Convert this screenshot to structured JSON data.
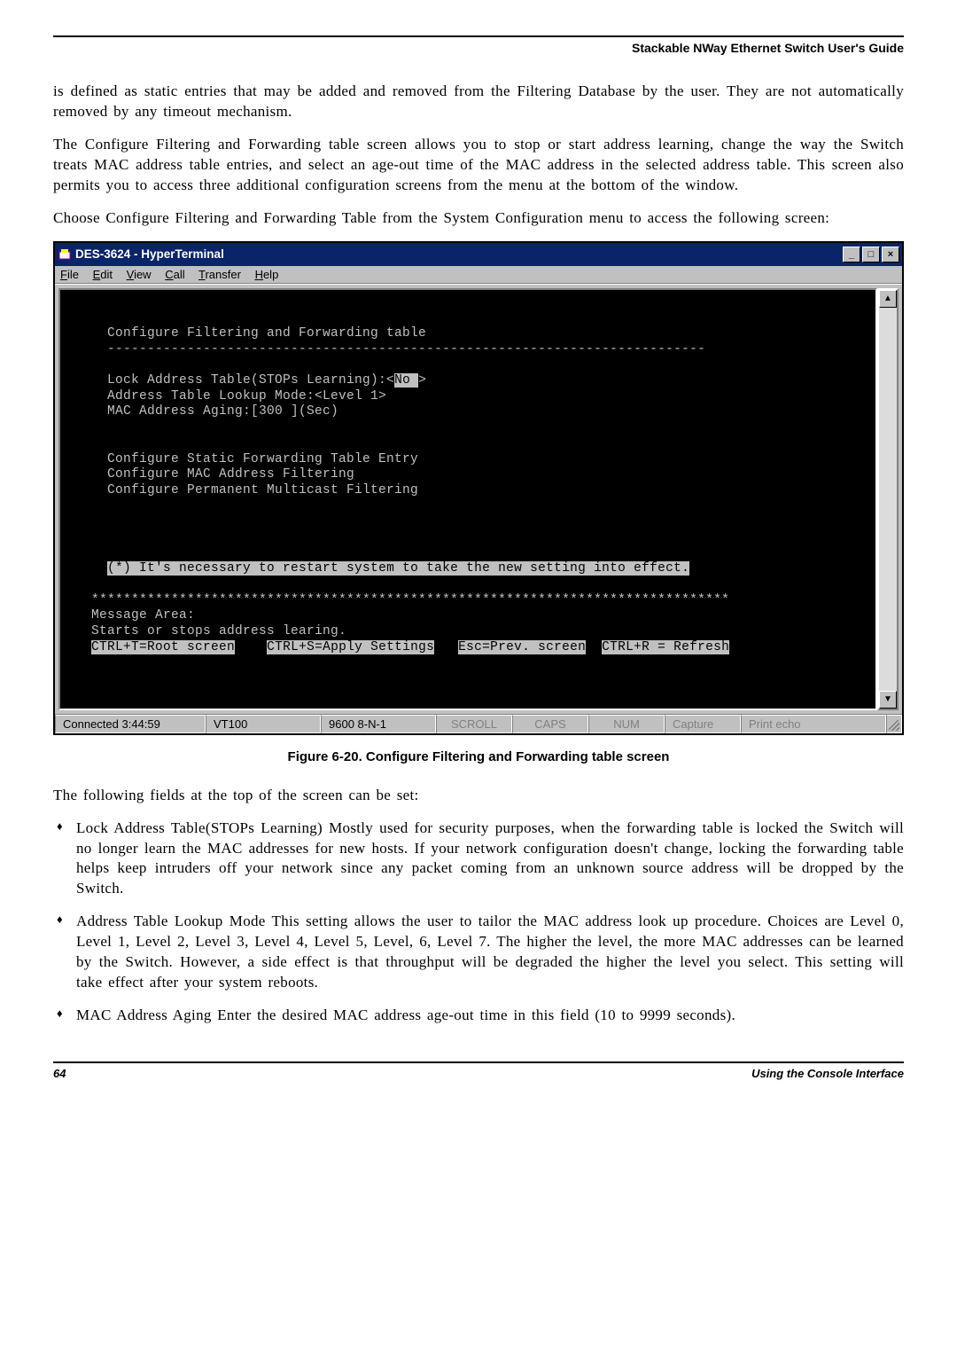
{
  "header": {
    "guide_title": "Stackable NWay Ethernet Switch User's Guide"
  },
  "paragraphs": {
    "p1": "is defined as static entries that may be added and removed from the Filtering Database by the user. They are not automatically removed by any timeout mechanism.",
    "p2": "The Configure Filtering and Forwarding table screen allows you to stop or start address learning, change the way the Switch treats MAC address table entries, and select an age-out time of the MAC address in the selected address table. This screen also permits you to access three additional configuration screens from the menu at the bottom of the window.",
    "p3": "Choose Configure Filtering and Forwarding Table from the System Configuration menu to access the following screen:"
  },
  "window": {
    "title": "DES-3624 - HyperTerminal",
    "menu": {
      "file": "File",
      "edit": "Edit",
      "view": "View",
      "call": "Call",
      "transfer": "Transfer",
      "help": "Help"
    },
    "win_btns": {
      "min": "_",
      "max": "□",
      "close": "×"
    }
  },
  "terminal": {
    "line_title": "     Configure Filtering and Forwarding table",
    "line_sep": "     ---------------------------------------------------------------------------",
    "line_lock1": "     Lock Address Table(STOPs Learning):<",
    "line_lock_hl": "No ",
    "line_lock2": ">",
    "line_lookup": "     Address Table Lookup Mode:<Level 1>",
    "line_aging": "     MAC Address Aging:[300 ](Sec)",
    "line_cfg1": "     Configure Static Forwarding Table Entry",
    "line_cfg2": "     Configure MAC Address Filtering",
    "line_cfg3": "     Configure Permanent Multicast Filtering",
    "line_note_hl": "(*) It's necessary to restart system to take the new setting into effect.",
    "line_stars": "   ********************************************************************************",
    "line_msg": "   Message Area:",
    "line_starts": "   Starts or stops address learing.",
    "line_keys_a": "CTRL+T=Root screen",
    "line_keys_gap1": "    ",
    "line_keys_b": "CTRL+S=Apply Settings",
    "line_keys_gap2": "   ",
    "line_keys_c": "Esc=Prev. screen",
    "line_keys_gap3": "  ",
    "line_keys_d": "CTRL+R = Refresh"
  },
  "statusbar": {
    "connected": "Connected 3:44:59",
    "emulation": "VT100",
    "port": "9600 8-N-1",
    "scroll": "SCROLL",
    "caps": "CAPS",
    "num": "NUM",
    "capture": "Capture",
    "printecho": "Print echo"
  },
  "figure_caption": "Figure 6-20.  Configure Filtering and Forwarding table screen",
  "after_fig_intro": "The following fields at the top of the screen can be set:",
  "bullets": {
    "b1": "Lock Address Table(STOPs Learning)  Mostly used for security purposes, when the forwarding table is locked the Switch will no longer learn the MAC addresses for new hosts. If your network configuration doesn't change, locking the forwarding table helps keep intruders off your network since any packet coming from an unknown source address will be dropped by the Switch.",
    "b2": "Address Table Lookup Mode  This setting allows the user to tailor the MAC address look up procedure. Choices are Level 0, Level 1, Level 2, Level 3, Level 4, Level 5, Level, 6, Level 7. The higher the level, the more MAC addresses can be learned by the Switch. However, a side effect is that throughput will be degraded the higher the level you select. This setting will take effect after your system reboots.",
    "b3": "MAC Address Aging  Enter the desired MAC address age-out time in this field (10 to 9999 seconds)."
  },
  "footer": {
    "page": "64",
    "section": "Using the Console Interface"
  }
}
